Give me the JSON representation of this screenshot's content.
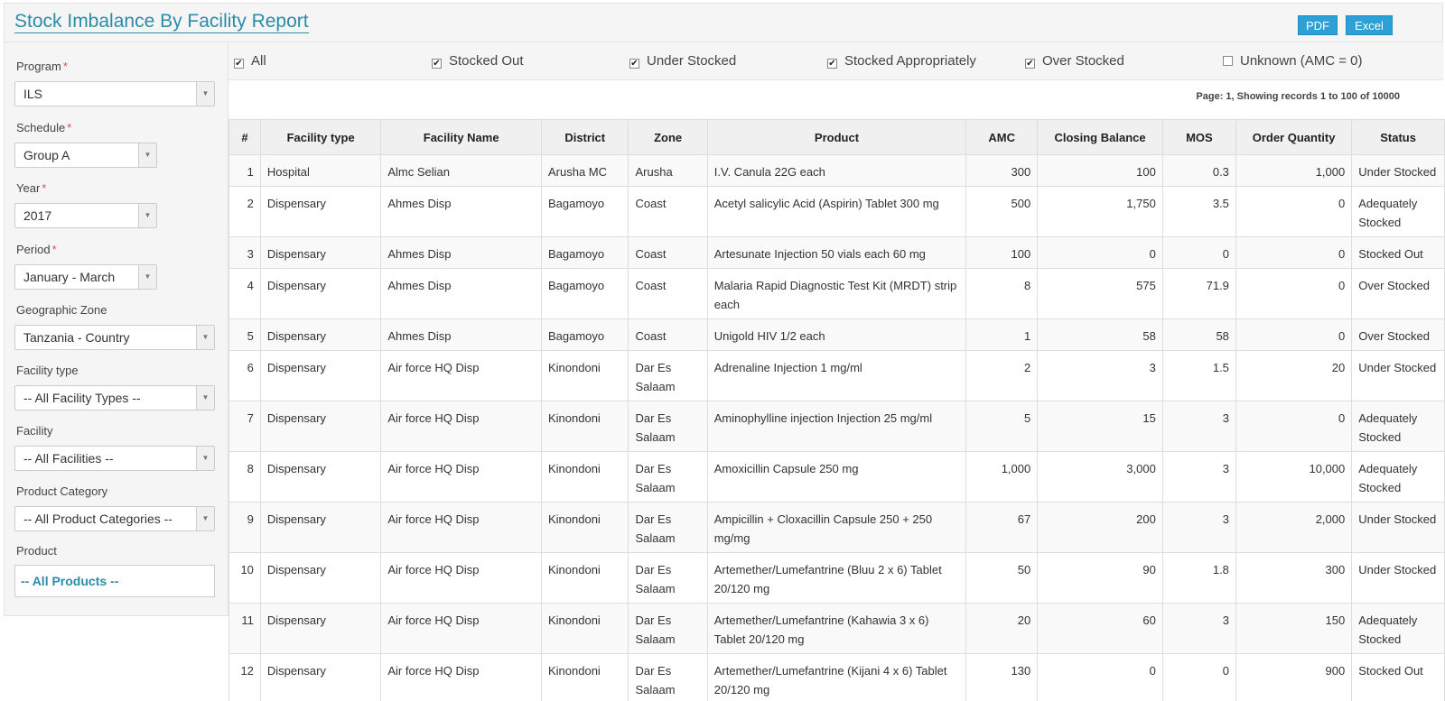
{
  "header": {
    "title": "Stock Imbalance By Facility Report",
    "pdf_label": "PDF",
    "excel_label": "Excel"
  },
  "sidebar": {
    "program": {
      "label": "Program",
      "value": "ILS"
    },
    "schedule": {
      "label": "Schedule",
      "value": "Group A"
    },
    "year": {
      "label": "Year",
      "value": "2017"
    },
    "period": {
      "label": "Period",
      "value": "January - March"
    },
    "zone": {
      "label": "Geographic Zone",
      "value": "Tanzania - Country"
    },
    "facility_type": {
      "label": "Facility type",
      "value": "-- All Facility Types --"
    },
    "facility": {
      "label": "Facility",
      "value": "-- All Facilities --"
    },
    "product_category": {
      "label": "Product Category",
      "value": "-- All Product Categories --"
    },
    "product": {
      "label": "Product",
      "value": "-- All Products --"
    },
    "required_mark": "*"
  },
  "filters": [
    {
      "label": "All",
      "checked": true
    },
    {
      "label": "Stocked Out",
      "checked": true
    },
    {
      "label": "Under Stocked",
      "checked": true
    },
    {
      "label": "Stocked Appropriately",
      "checked": true
    },
    {
      "label": "Over Stocked",
      "checked": true
    },
    {
      "label": "Unknown (AMC = 0)",
      "checked": false
    }
  ],
  "paging": "Page: 1, Showing records 1 to 100 of 10000",
  "table": {
    "columns": [
      "#",
      "Facility type",
      "Facility Name",
      "District",
      "Zone",
      "Product",
      "AMC",
      "Closing Balance",
      "MOS",
      "Order Quantity",
      "Status"
    ],
    "rows": [
      [
        "1",
        "Hospital",
        "Almc Selian",
        "Arusha MC",
        "Arusha",
        "I.V. Canula 22G each",
        "300",
        "100",
        "0.3",
        "1,000",
        "Under Stocked"
      ],
      [
        "2",
        "Dispensary",
        "Ahmes Disp",
        "Bagamoyo",
        "Coast",
        "Acetyl salicylic Acid (Aspirin) Tablet 300 mg",
        "500",
        "1,750",
        "3.5",
        "0",
        "Adequately Stocked"
      ],
      [
        "3",
        "Dispensary",
        "Ahmes Disp",
        "Bagamoyo",
        "Coast",
        "Artesunate Injection 50 vials each 60 mg",
        "100",
        "0",
        "0",
        "0",
        "Stocked Out"
      ],
      [
        "4",
        "Dispensary",
        "Ahmes Disp",
        "Bagamoyo",
        "Coast",
        "Malaria Rapid Diagnostic Test Kit (MRDT) strip each",
        "8",
        "575",
        "71.9",
        "0",
        "Over Stocked"
      ],
      [
        "5",
        "Dispensary",
        "Ahmes Disp",
        "Bagamoyo",
        "Coast",
        "Unigold HIV 1/2 each",
        "1",
        "58",
        "58",
        "0",
        "Over Stocked"
      ],
      [
        "6",
        "Dispensary",
        "Air force HQ Disp",
        "Kinondoni",
        "Dar Es Salaam",
        "Adrenaline Injection 1 mg/ml",
        "2",
        "3",
        "1.5",
        "20",
        "Under Stocked"
      ],
      [
        "7",
        "Dispensary",
        "Air force HQ Disp",
        "Kinondoni",
        "Dar Es Salaam",
        "Aminophylline injection Injection 25 mg/ml",
        "5",
        "15",
        "3",
        "0",
        "Adequately Stocked"
      ],
      [
        "8",
        "Dispensary",
        "Air force HQ Disp",
        "Kinondoni",
        "Dar Es Salaam",
        "Amoxicillin Capsule 250 mg",
        "1,000",
        "3,000",
        "3",
        "10,000",
        "Adequately Stocked"
      ],
      [
        "9",
        "Dispensary",
        "Air force HQ Disp",
        "Kinondoni",
        "Dar Es Salaam",
        "Ampicillin + Cloxacillin Capsule 250 + 250 mg/mg",
        "67",
        "200",
        "3",
        "2,000",
        "Under Stocked"
      ],
      [
        "10",
        "Dispensary",
        "Air force HQ Disp",
        "Kinondoni",
        "Dar Es Salaam",
        "Artemether/Lumefantrine (Bluu 2 x 6) Tablet 20/120 mg",
        "50",
        "90",
        "1.8",
        "300",
        "Under Stocked"
      ],
      [
        "11",
        "Dispensary",
        "Air force HQ Disp",
        "Kinondoni",
        "Dar Es Salaam",
        "Artemether/Lumefantrine (Kahawia 3 x 6) Tablet 20/120 mg",
        "20",
        "60",
        "3",
        "150",
        "Adequately Stocked"
      ],
      [
        "12",
        "Dispensary",
        "Air force HQ Disp",
        "Kinondoni",
        "Dar Es Salaam",
        "Artemether/Lumefantrine (Kijani 4 x 6) Tablet 20/120 mg",
        "130",
        "0",
        "0",
        "900",
        "Stocked Out"
      ]
    ]
  },
  "status_colors": {
    "Under Stocked": "#f0a030",
    "Adequately Stocked": "#3cb34a",
    "Stocked Out": "#e84040",
    "Over Stocked": "#34a8e0"
  }
}
